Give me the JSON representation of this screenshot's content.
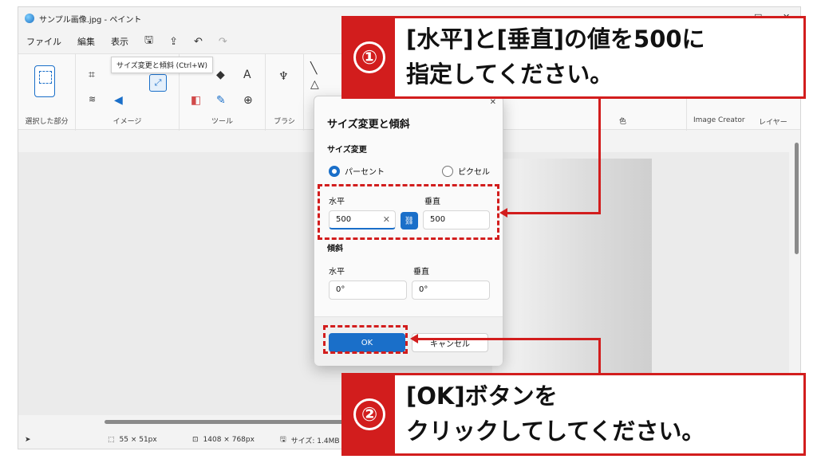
{
  "window": {
    "title": "サンプル画像.jpg - ペイント",
    "controls": [
      "—",
      "□",
      "✕"
    ]
  },
  "menu": {
    "file": "ファイル",
    "edit": "編集",
    "view": "表示"
  },
  "ribbon": {
    "groups": {
      "selection": "選択した部分",
      "image": "イメージ",
      "tools": "ツール",
      "brushes": "ブラシ",
      "colors": "色",
      "image_creator": "Image Creator",
      "layers": "レイヤー"
    },
    "tooltip": "サイズ変更と傾斜 (Ctrl+W)",
    "text_tool_glyph": "A"
  },
  "status": {
    "selection_size": "55 × 51px",
    "image_size": "1408 × 768px",
    "file_size": "サイズ: 1.4MB"
  },
  "dialog": {
    "title": "サイズ変更と傾斜",
    "resize_heading": "サイズ変更",
    "mode_percent": "パーセント",
    "mode_pixel": "ピクセル",
    "resize": {
      "horizontal_label": "水平",
      "vertical_label": "垂直",
      "horizontal_value": "500",
      "vertical_value": "500"
    },
    "skew_heading": "傾斜",
    "skew": {
      "horizontal_label": "水平",
      "vertical_label": "垂直",
      "horizontal_value": "0°",
      "vertical_value": "0°"
    },
    "ok_label": "OK",
    "cancel_label": "キャンセル"
  },
  "callouts": {
    "one": {
      "number": "①",
      "line1": "[水平]と[垂直]の値を500に",
      "line2": "指定してください。"
    },
    "two": {
      "number": "②",
      "line1": "[OK]ボタンを",
      "line2": "クリックしてしてください。"
    }
  },
  "colors": {
    "accent": "#1a6fc9",
    "annotation_red": "#d21d1d"
  }
}
